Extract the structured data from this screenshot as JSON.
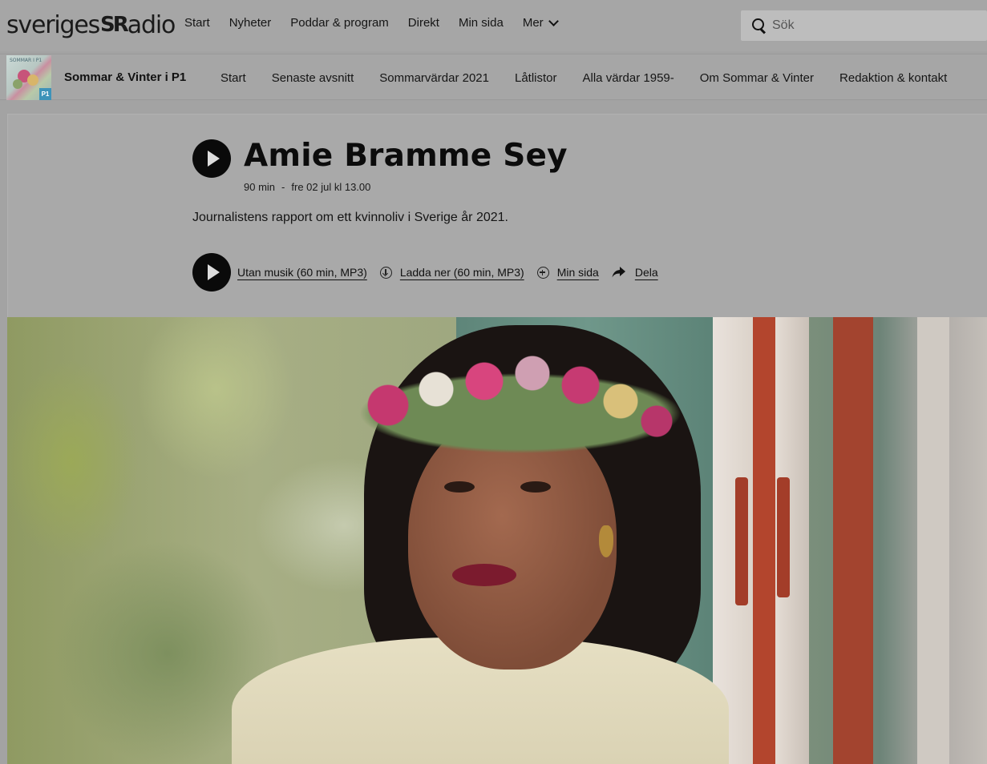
{
  "brand": {
    "logo_left": "sveriges",
    "logo_mark": "SR",
    "logo_right": "adio"
  },
  "mainnav": {
    "items": [
      "Start",
      "Nyheter",
      "Poddar & program",
      "Direkt",
      "Min sida"
    ],
    "more_label": "Mer"
  },
  "search": {
    "placeholder": "Sök",
    "value": ""
  },
  "program": {
    "thumb_label": "SOMMAR I P1",
    "thumb_badge": "P1",
    "title": "Sommar & Vinter i P1",
    "nav": [
      "Start",
      "Senaste avsnitt",
      "Sommarvärdar 2021",
      "Låtlistor",
      "Alla värdar 1959-",
      "Om Sommar & Vinter",
      "Redaktion & kontakt"
    ]
  },
  "episode": {
    "title": "Amie Bramme Sey",
    "duration": "90 min",
    "separator": "-",
    "date": "fre 02 jul kl 13.00",
    "description": "Journalistens rapport om ett kvinnoliv i Sverige år 2021.",
    "actions": {
      "no_music": "Utan musik (60 min, MP3)",
      "download": "Ladda ner (60 min, MP3)",
      "my_page": "Min sida",
      "share": "Dela"
    }
  }
}
